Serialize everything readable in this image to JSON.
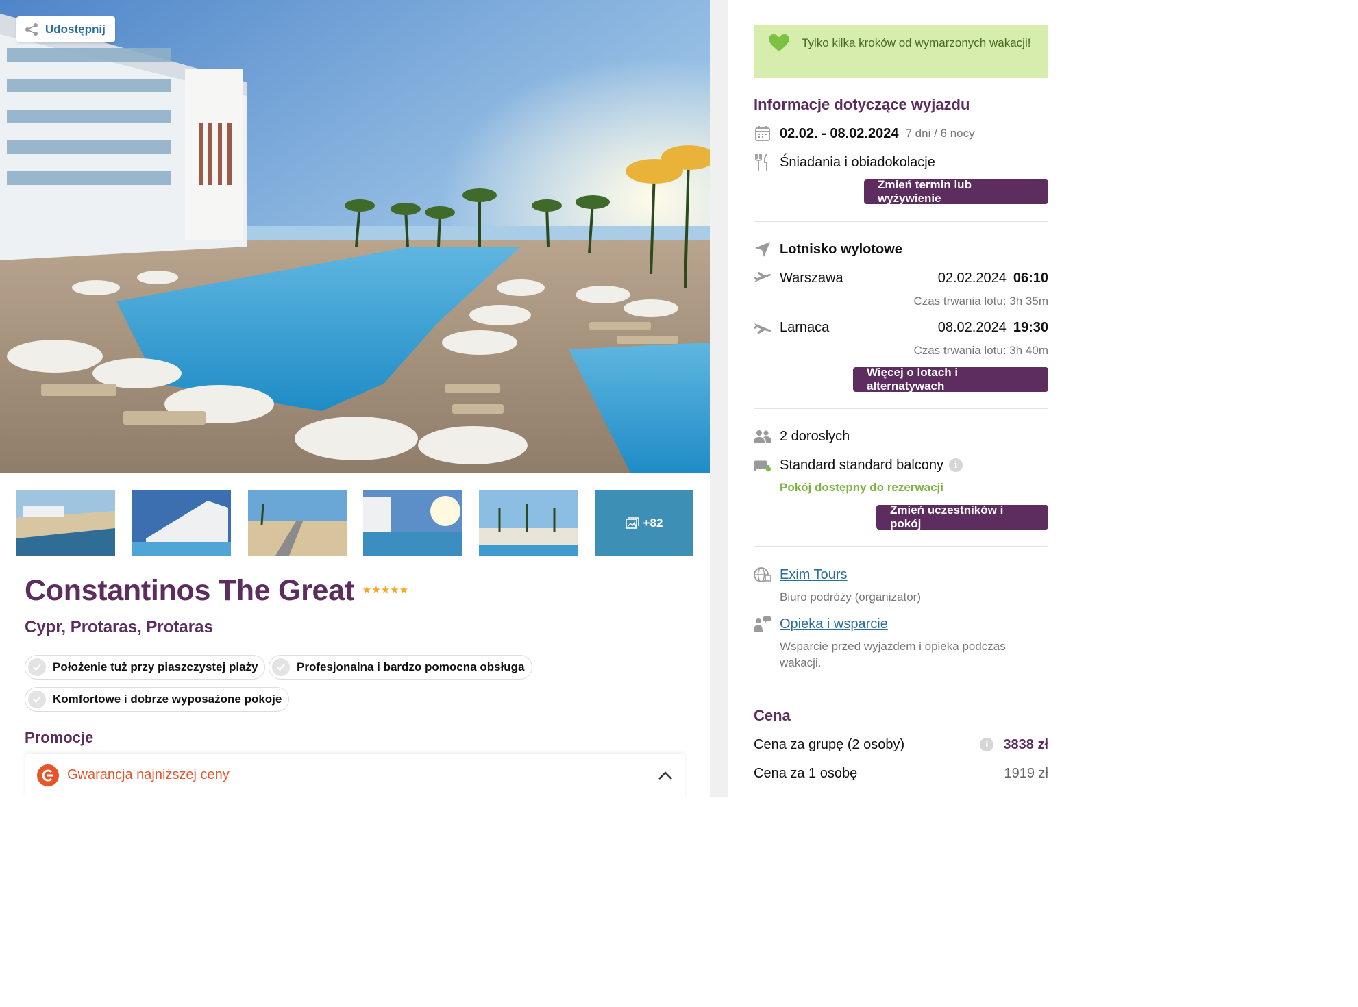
{
  "gallery": {
    "share_label": "Udostępnij",
    "more_photos": "+82"
  },
  "hotel": {
    "name": "Constantinos The Great",
    "stars": "★★★★★",
    "location": "Cypr, Protaras, Protaras",
    "highlights": [
      "Położenie tuż przy piaszczystej plaży",
      "Profesjonalna i bardzo pomocna obsługa",
      "Komfortowe i dobrze wyposażone pokoje"
    ]
  },
  "promotions": {
    "title": "Promocje",
    "item": "Gwarancja najniższej ceny"
  },
  "sidebar": {
    "notice": "Tylko kilka kroków od wymarzonych wakacji!",
    "trip_info_title": "Informacje dotyczące wyjazdu",
    "dates": "02.02. - 08.02.2024",
    "duration": "7 dni / 6 nocy",
    "board": "Śniadania i obiadokolacje",
    "change_term_button": "Zmień termin lub wyżywienie",
    "departure_airport_label": "Lotnisko wylotowe",
    "outbound": {
      "city": "Warszawa",
      "date": "02.02.2024",
      "time": "06:10",
      "duration": "Czas trwania lotu: 3h 35m"
    },
    "inbound": {
      "city": "Larnaca",
      "date": "08.02.2024",
      "time": "19:30",
      "duration": "Czas trwania lotu: 3h 40m"
    },
    "flights_button": "Więcej o lotach i alternatywach",
    "participants": "2 dorosłych",
    "room": "Standard standard balcony",
    "room_status": "Pokój dostępny do rezerwacji",
    "change_participants_button": "Zmień uczestników i pokój",
    "organizer_name": "Exim Tours",
    "organizer_desc": "Biuro podróży (organizator)",
    "support_link": "Opieka i wsparcie",
    "support_desc": "Wsparcie przed wyjazdem i opieka podczas wakacji.",
    "price_title": "Cena",
    "group_price_label": "Cena za grupę (2 osoby)",
    "group_price": "3838 zł",
    "per_person_label": "Cena za 1 osobę",
    "per_person_price": "1919 zł"
  },
  "colors": {
    "brand_purple": "#5c2d5e",
    "link_blue": "#2a6e9b",
    "available_green": "#7cb342",
    "notice_bg": "#d6edae",
    "promo_orange": "#e8542a"
  }
}
